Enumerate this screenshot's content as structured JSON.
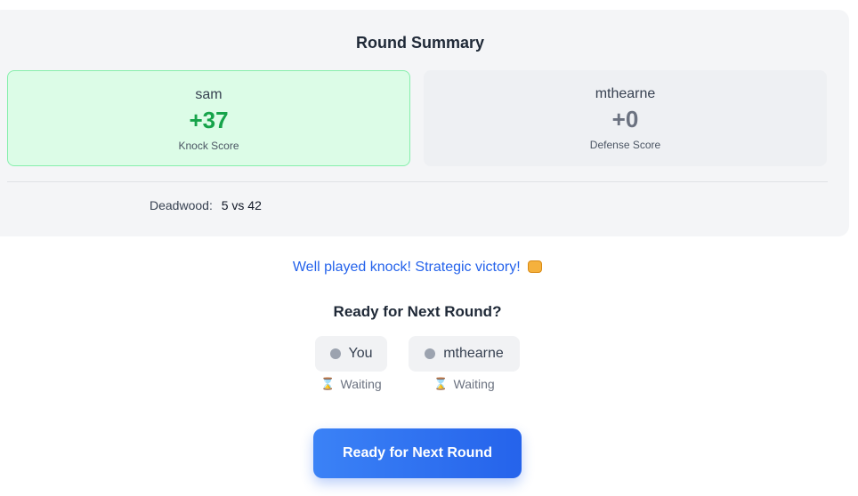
{
  "summary": {
    "title": "Round Summary",
    "knocker": {
      "name": "sam",
      "score": "+37",
      "label": "Knock Score"
    },
    "defender": {
      "name": "mthearne",
      "score": "+0",
      "label": "Defense Score"
    },
    "deadwood": {
      "label": "Deadwood:",
      "value": "5 vs 42"
    }
  },
  "message": "Well played knock! Strategic victory!",
  "ready": {
    "title": "Ready for Next Round?",
    "players": [
      {
        "name": "You",
        "status": "Waiting"
      },
      {
        "name": "mthearne",
        "status": "Waiting"
      }
    ],
    "button_label": "Ready for Next Round"
  },
  "colors": {
    "accent": "#2563eb",
    "win": "#16a34a",
    "win_bg": "#dcfce7"
  },
  "icons": {
    "status_dot": "status-dot-icon",
    "waiting": "hourglass-icon",
    "message": "fist-icon"
  }
}
